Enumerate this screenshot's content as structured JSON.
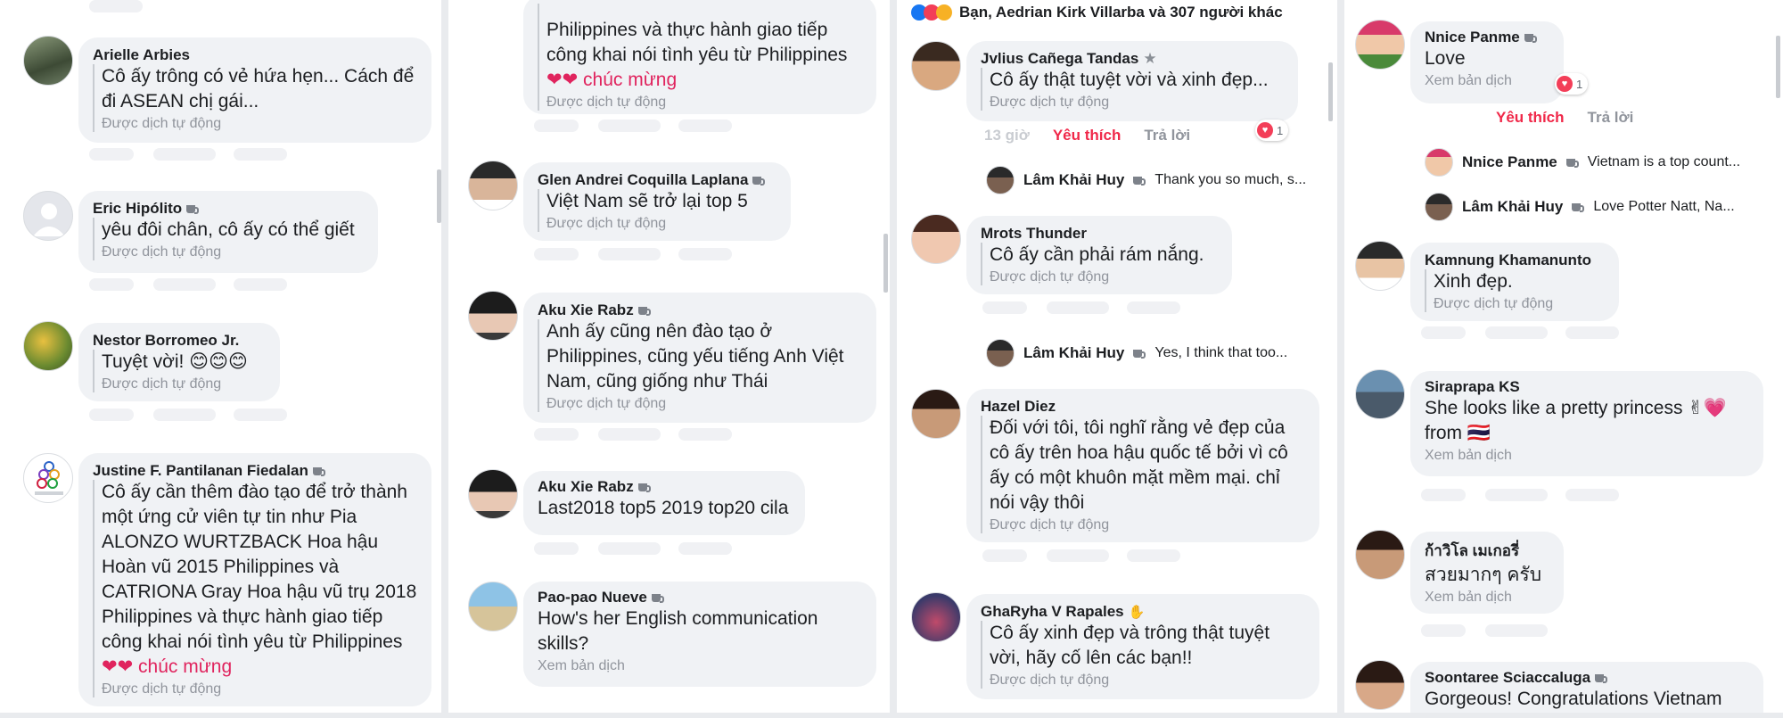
{
  "auto_translated": "Được dịch tự động",
  "see_translation": "Xem bản dịch",
  "like": "Yêu thích",
  "reply": "Trả lời",
  "panel1": {
    "comments": [
      {
        "name": "Arielle Arbies",
        "text1": "Cô ấy trông có vẻ hứa hẹn... Cách để",
        "text2": "đi ASEAN chị gái..."
      },
      {
        "name": "Eric Hipólito",
        "text1": "yêu đôi chân, cô ấy có thể giết"
      },
      {
        "name": "Nestor Borromeo Jr.",
        "text1": "Tuyệt vời! 😊😊😊"
      },
      {
        "name": "Justine F. Pantilanan Fiedalan",
        "lines": [
          "Cô ấy cần thêm đào tạo để trở thành",
          "một ứng cử viên tự tin như Pia",
          "ALONZO WURTZBACK Hoa hậu",
          "Hoàn vũ 2015 Philippines và",
          "CATRIONA Gray Hoa hậu vũ trụ 2018",
          "Philippines và thực hành giao tiếp",
          "công khai nói tình yêu từ Philippines",
          "❤❤ chúc mừng"
        ]
      }
    ]
  },
  "panel2": {
    "top_lines": [
      "Philippines và thực hành giao tiếp",
      "công khai nói tình yêu từ Philippines",
      "❤❤ chúc mừng"
    ],
    "comments": [
      {
        "name": "Glen Andrei Coquilla Laplana",
        "text1": "Việt Nam sẽ trở lại top 5"
      },
      {
        "name": "Aku Xie Rabz",
        "lines": [
          "Anh ấy cũng nên đào tạo ở",
          "Philippines, cũng yếu tiếng Anh Việt",
          "Nam, cũng giống như Thái"
        ]
      },
      {
        "name": "Aku Xie Rabz",
        "text1": "Last2018 top5 2019 top20 cila"
      },
      {
        "name": "Pao-pao Nueve",
        "lines": [
          "How's her English communication",
          "skills?"
        ]
      }
    ]
  },
  "panel3": {
    "top_reactions_text": "Bạn, Aedrian Kirk Villarba và 307 người khác",
    "comments": [
      {
        "name": "Jvlius Cañega Tandas",
        "text1": "Cô ấy thật tuyệt vời và xinh đẹp...",
        "heart_count": "1"
      },
      {
        "name": "Mrots Thunder",
        "text1": "Cô ấy cần phải rám nắng."
      },
      {
        "name": "Hazel Diez",
        "lines": [
          "Đối với tôi, tôi nghĩ rằng vẻ đẹp của",
          "cô ấy trên hoa hậu quốc tế bởi vì cô",
          "ấy có một khuôn mặt mềm mại. chỉ",
          "nói vậy thôi"
        ]
      },
      {
        "name": "GhaRyha V Rapales",
        "lines": [
          "Cô ấy xinh đẹp và trông thật tuyệt",
          "vời, hãy cố lên các bạn!!"
        ]
      }
    ],
    "replies": [
      {
        "name": "Lâm Khải Huy",
        "text": "Thank you so much, s..."
      },
      {
        "name": "Lâm Khải Huy",
        "text": "Yes, I think that too..."
      }
    ],
    "time_ghost": "13 giờ"
  },
  "panel4": {
    "comments": [
      {
        "name": "Nnice Panme",
        "text1": "Love",
        "heart_count": "1"
      },
      {
        "name": "Kamnung Khamanunto",
        "text1": "Xinh đẹp."
      },
      {
        "name": "Siraprapa KS",
        "lines": [
          "She looks like a pretty princess ✌💗",
          "from 🇹🇭"
        ]
      },
      {
        "name": "ก้าวิโล เมเกอรี่",
        "text1": "สวยมากๆ ครับ"
      },
      {
        "name": "Soontaree Sciaccaluga",
        "text1": "Gorgeous! Congratulations Vietnam"
      }
    ],
    "replies": [
      {
        "name": "Nnice Panme",
        "text": "Vietnam is a top count..."
      },
      {
        "name": "Lâm Khải Huy",
        "text": "Love Potter Natt, Na..."
      }
    ]
  },
  "colors": {
    "like": "#f02849",
    "bubble": "#f0f2f5",
    "muted": "#90949c"
  }
}
